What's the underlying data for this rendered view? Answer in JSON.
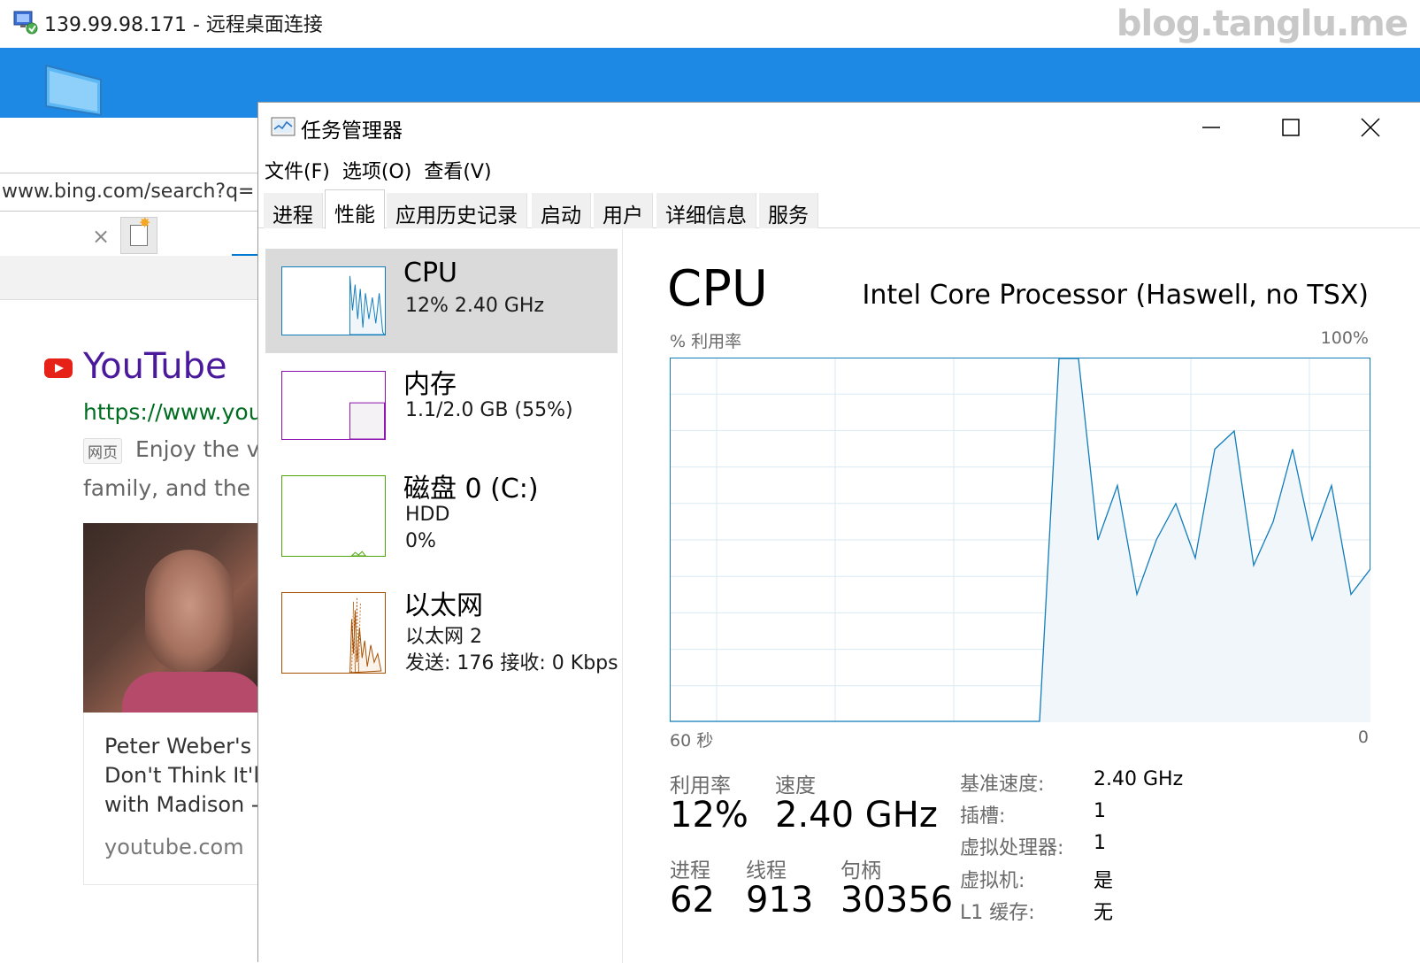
{
  "rdp": {
    "title": "139.99.98.171 - 远程桌面连接",
    "watermark": "blog.tanglu.me"
  },
  "browser": {
    "url": "www.bing.com/search?q=",
    "tab_close": "×",
    "result": {
      "title": "YouTube",
      "url": "https://www.yout",
      "badge": "网页",
      "desc_line1": "Enjoy the vi",
      "desc_line2": "family, and the w"
    },
    "video": {
      "title_lines": [
        "Peter Weber's",
        "Don't Think It'l",
        "with Madison -"
      ],
      "source": "youtube.com"
    }
  },
  "task_manager": {
    "title": "任务管理器",
    "menu": [
      "文件(F)",
      "选项(O)",
      "查看(V)"
    ],
    "tabs": [
      "进程",
      "性能",
      "应用历史记录",
      "启动",
      "用户",
      "详细信息",
      "服务"
    ],
    "active_tab": "性能",
    "resources": [
      {
        "name": "CPU",
        "lines": [
          "12%  2.40 GHz"
        ],
        "color": "#117dbb"
      },
      {
        "name": "内存",
        "lines": [
          "1.1/2.0 GB (55%)"
        ],
        "color": "#8b12ae"
      },
      {
        "name": "磁盘 0 (C:)",
        "lines": [
          "HDD",
          "0%"
        ],
        "color": "#4da60c"
      },
      {
        "name": "以太网",
        "lines": [
          "以太网 2",
          "发送: 176  接收: 0 Kbps"
        ],
        "color": "#a74f01"
      }
    ],
    "detail": {
      "title": "CPU",
      "model": "Intel Core Processor (Haswell, no TSX)",
      "graph_label_left": "% 利用率",
      "graph_label_right": "100%",
      "graph_time_left": "60 秒",
      "graph_time_right": "0",
      "stats": {
        "utilization_label": "利用率",
        "utilization": "12%",
        "speed_label": "速度",
        "speed": "2.40 GHz",
        "processes_label": "进程",
        "processes": "62",
        "threads_label": "线程",
        "threads": "913",
        "handles_label": "句柄",
        "handles": "30356"
      },
      "specs": [
        {
          "key": "基准速度:",
          "value": "2.40 GHz"
        },
        {
          "key": "插槽:",
          "value": "1"
        },
        {
          "key": "虚拟处理器:",
          "value": "1"
        },
        {
          "key": "虚拟机:",
          "value": "是"
        },
        {
          "key": "L1 缓存:",
          "value": "无"
        }
      ]
    }
  },
  "chart_data": {
    "type": "area",
    "x": [
      0,
      2,
      4,
      6,
      8,
      10,
      12,
      14,
      16,
      18,
      20,
      22,
      24,
      26,
      28,
      30,
      32,
      34,
      36,
      38,
      40,
      42,
      44,
      46,
      48,
      50,
      52,
      54,
      56,
      58,
      60
    ],
    "values": [
      0,
      0,
      0,
      0,
      0,
      0,
      0,
      0,
      0,
      0,
      0,
      0,
      0,
      0,
      0,
      0,
      0,
      0,
      0,
      0,
      100,
      100,
      50,
      65,
      35,
      50,
      60,
      45,
      75,
      80,
      43,
      55,
      75,
      50,
      65,
      35,
      42
    ],
    "xlim": [
      60,
      0
    ],
    "ylim": [
      0,
      100
    ],
    "xlabel": "60 秒",
    "ylabel": "% 利用率",
    "color": "#117dbb",
    "fill": "#f1f6fa",
    "grid": true
  }
}
